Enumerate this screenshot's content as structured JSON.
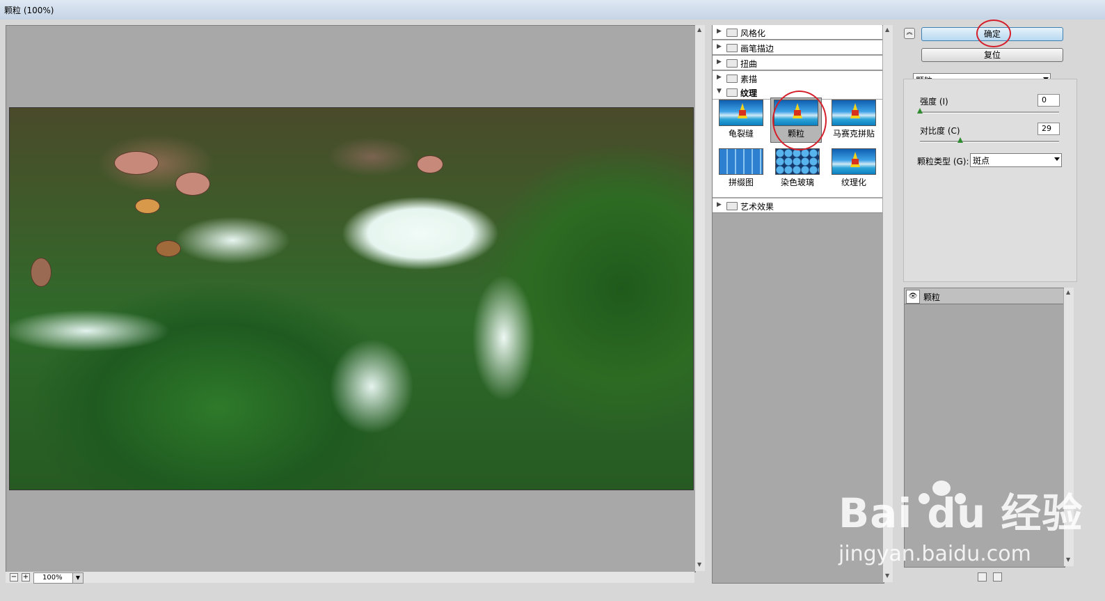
{
  "window": {
    "title": "颗粒 (100%)"
  },
  "preview": {
    "zoom": "100%",
    "zoom_out": "−",
    "zoom_in": "+"
  },
  "filter_tree": {
    "categories": [
      {
        "label": "风格化",
        "expanded": false
      },
      {
        "label": "画笔描边",
        "expanded": false
      },
      {
        "label": "扭曲",
        "expanded": false
      },
      {
        "label": "素描",
        "expanded": false
      },
      {
        "label": "纹理",
        "expanded": true
      },
      {
        "label": "艺术效果",
        "expanded": false
      }
    ],
    "texture_filters": [
      "龟裂缝",
      "颗粒",
      "马赛克拼贴",
      "拼缀图",
      "染色玻璃",
      "纹理化"
    ],
    "selected": "颗粒"
  },
  "buttons": {
    "ok": "确定",
    "reset": "复位"
  },
  "filter_select": {
    "value": "颗粒"
  },
  "params": {
    "intensity_label": "强度 (I)",
    "intensity_value": "0",
    "intensity_fraction": 0.0,
    "contrast_label": "对比度 (C)",
    "contrast_value": "29",
    "contrast_fraction": 0.29,
    "grain_type_label": "颗粒类型 (G):",
    "grain_type_value": "斑点"
  },
  "layers": {
    "items": [
      {
        "label": "颗粒",
        "visible": true
      }
    ]
  },
  "watermark": {
    "brand": "Bai du 经验",
    "url": "jingyan.baidu.com"
  },
  "colors": {
    "accent_ring": "#d41f2a",
    "primary_button": "#b7d8f1"
  }
}
